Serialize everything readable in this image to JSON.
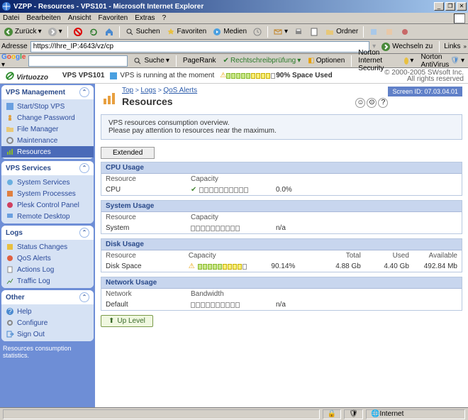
{
  "window": {
    "title": "VZPP - Resources - VPS101 - Microsoft Internet Explorer"
  },
  "menu": {
    "datei": "Datei",
    "bearbeiten": "Bearbeiten",
    "ansicht": "Ansicht",
    "favoriten": "Favoriten",
    "extras": "Extras",
    "help": "?"
  },
  "toolbar": {
    "zurueck": "Zurück",
    "suchen": "Suchen",
    "favoriten": "Favoriten",
    "medien": "Medien",
    "ordner": "Ordner"
  },
  "address": {
    "label": "Adresse",
    "value": "https://Ihre_IP:4643/vz/cp",
    "wechseln": "Wechseln zu",
    "links": "Links"
  },
  "google": {
    "label": "Google",
    "suche": "Suche",
    "pagerank": "PageRank",
    "recht": "Rechtschreibprüfung",
    "optionen": "Optionen",
    "nis": "Norton Internet Security",
    "nav": "Norton AntiVirus"
  },
  "app": {
    "logo": "Virtuozzo",
    "vps_label": "VPS VPS101",
    "running": "VPS is running at the moment",
    "space_used": "90% Space Used",
    "copyright1": "© 2000-2005 SWsoft Inc.",
    "copyright2": "All rights reserved"
  },
  "sidebar": {
    "mgmt": {
      "title": "VPS Management",
      "items": [
        "Start/Stop VPS",
        "Change Password",
        "File Manager",
        "Maintenance",
        "Resources"
      ]
    },
    "svc": {
      "title": "VPS Services",
      "items": [
        "System Services",
        "System Processes",
        "Plesk Control Panel",
        "Remote Desktop"
      ]
    },
    "logs": {
      "title": "Logs",
      "items": [
        "Status Changes",
        "QoS Alerts",
        "Actions Log",
        "Traffic Log"
      ]
    },
    "other": {
      "title": "Other",
      "items": [
        "Help",
        "Configure",
        "Sign Out"
      ]
    },
    "foot": "Resources consumption statistics."
  },
  "page": {
    "bc_top": "Top",
    "bc_logs": "Logs",
    "bc_qos": "QoS Alerts",
    "title": "Resources",
    "screen_id": "Screen ID: 07.03.04.01",
    "info1": "VPS resources consumption overview.",
    "info2": "Please pay attention to resources near the maximum.",
    "extended": "Extended",
    "cpu": {
      "title": "CPU Usage",
      "resource": "Resource",
      "capacity": "Capacity",
      "name": "CPU",
      "pct": "0.0%"
    },
    "sys": {
      "title": "System Usage",
      "resource": "Resource",
      "capacity": "Capacity",
      "name": "System",
      "pct": "n/a"
    },
    "disk": {
      "title": "Disk Usage",
      "resource": "Resource",
      "capacity": "Capacity",
      "total_h": "Total",
      "used_h": "Used",
      "avail_h": "Available",
      "name": "Disk Space",
      "pct": "90.14%",
      "total": "4.88 Gb",
      "used": "4.40 Gb",
      "avail": "492.84 Mb"
    },
    "net": {
      "title": "Network Usage",
      "resource": "Network",
      "bandwidth": "Bandwidth",
      "name": "Default",
      "pct": "n/a"
    },
    "uplevel": "Up Level"
  },
  "status": {
    "internet": "Internet"
  }
}
